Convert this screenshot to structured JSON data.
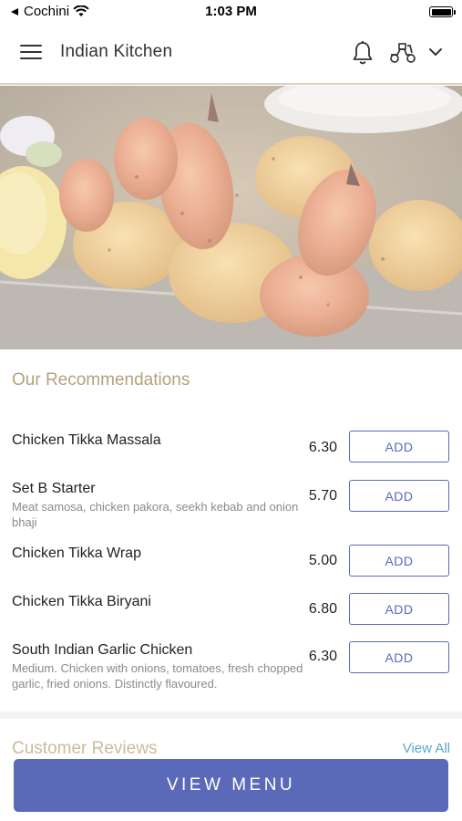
{
  "status_bar": {
    "carrier": "Cochini",
    "time": "1:03 PM"
  },
  "header": {
    "title": "Indian Kitchen"
  },
  "recommendations": {
    "title": "Our Recommendations",
    "add_label": "ADD",
    "items": [
      {
        "name": "Chicken Tikka Massala",
        "description": "",
        "price": "6.30"
      },
      {
        "name": "Set B Starter",
        "description": "Meat samosa, chicken pakora, seekh kebab and onion bhaji",
        "price": "5.70"
      },
      {
        "name": "Chicken Tikka Wrap",
        "description": "",
        "price": "5.00"
      },
      {
        "name": "Chicken Tikka Biryani",
        "description": "",
        "price": "6.80"
      },
      {
        "name": "South Indian Garlic Chicken",
        "description": "Medium. Chicken with onions, tomatoes, fresh chopped garlic, fried onions. Distinctly flavoured.",
        "price": "6.30"
      }
    ]
  },
  "reviews": {
    "title": "Customer Reviews",
    "view_all": "View All"
  },
  "footer": {
    "view_menu_label": "VIEW MENU"
  },
  "colors": {
    "accent": "#5a6ab8",
    "section_title": "#b4a27c",
    "link": "#5aa7c7"
  },
  "icons": [
    "menu-icon",
    "bell-icon",
    "delivery-scooter-icon",
    "chevron-down-icon",
    "wifi-icon",
    "battery-icon"
  ]
}
